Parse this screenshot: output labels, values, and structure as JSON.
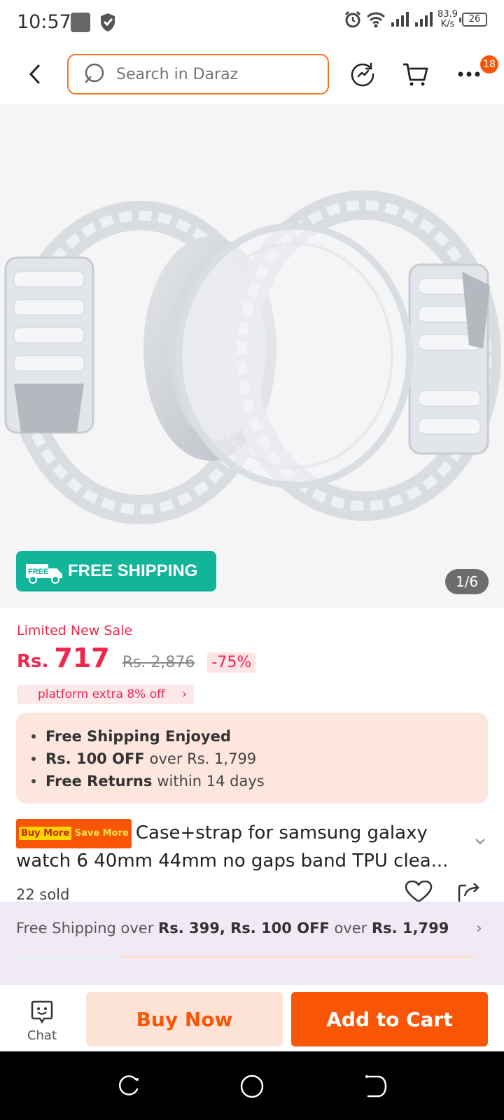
{
  "status_bar": {
    "time": "10:57",
    "net_speed_value": "83.9",
    "net_speed_unit": "K/s",
    "battery": "26"
  },
  "header": {
    "search_placeholder": "Search in Daraz",
    "cart_badge": "18",
    "icons": [
      "back-icon",
      "search-icon",
      "refresh-icon",
      "cart-icon",
      "more-icon"
    ],
    "accent_color": "#f57224"
  },
  "gallery": {
    "free_shipping_truck_label": "FREE",
    "free_shipping_label": "FREE SHIPPING",
    "counter": "1/6"
  },
  "price": {
    "sale_label": "Limited New Sale",
    "currency": "Rs.",
    "current": "717",
    "original": "Rs. 2,876",
    "discount": "-75%",
    "voucher": "platform extra 8% off",
    "color": "#f0264f"
  },
  "benefits": [
    {
      "bold": "Free Shipping Enjoyed",
      "rest": ""
    },
    {
      "bold": "Rs. 100 OFF",
      "rest": "over Rs. 1,799"
    },
    {
      "bold": "Free Returns",
      "rest": "within 14 days"
    }
  ],
  "product": {
    "promo_badge_1": "Buy More",
    "promo_badge_2": "Save More",
    "title_line1": "Case+strap for samsung galaxy",
    "title_line2": "watch 6 40mm 44mm no gaps band TPU clea...",
    "sold": "22 sold"
  },
  "shipping_banner": {
    "part1": "Free Shipping over ",
    "bold1": "Rs. 399, Rs. 100 OFF",
    "part2": " over ",
    "bold2": "Rs. 1,799"
  },
  "actions": {
    "chat_label": "Chat",
    "buy_now": "Buy Now",
    "add_to_cart": "Add to Cart",
    "brand_color": "#f85606"
  }
}
